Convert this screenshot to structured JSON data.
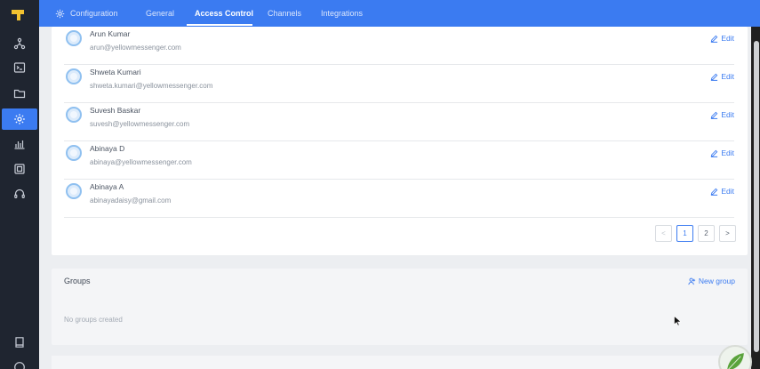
{
  "topbar": {
    "items": [
      "Configuration",
      "General",
      "Access Control",
      "Channels",
      "Integrations"
    ],
    "active": "Access Control"
  },
  "sidebar": {
    "icons": [
      "network-icon",
      "terminal-icon",
      "folder-icon",
      "gear-icon",
      "chart-icon",
      "copy-icon",
      "headset-icon",
      "book-icon",
      "help-icon"
    ],
    "active": "gear-icon"
  },
  "users": [
    {
      "name": "Arun Kumar",
      "email": "arun@yellowmessenger.com",
      "edit": "Edit"
    },
    {
      "name": "Shweta Kumari",
      "email": "shweta.kumari@yellowmessenger.com",
      "edit": "Edit"
    },
    {
      "name": "Suvesh Baskar",
      "email": "suvesh@yellowmessenger.com",
      "edit": "Edit"
    },
    {
      "name": "Abinaya D",
      "email": "abinaya@yellowmessenger.com",
      "edit": "Edit"
    },
    {
      "name": "Abinaya A",
      "email": "abinayadaisy@gmail.com",
      "edit": "Edit"
    }
  ],
  "pagination": {
    "prev": "<",
    "pages": [
      "1",
      "2"
    ],
    "current": "1",
    "next": ">"
  },
  "groups": {
    "title": "Groups",
    "new_group": "New group",
    "empty": "No groups created"
  },
  "colors": {
    "accent": "#3b7bf1",
    "sidebar": "#1f2530"
  }
}
